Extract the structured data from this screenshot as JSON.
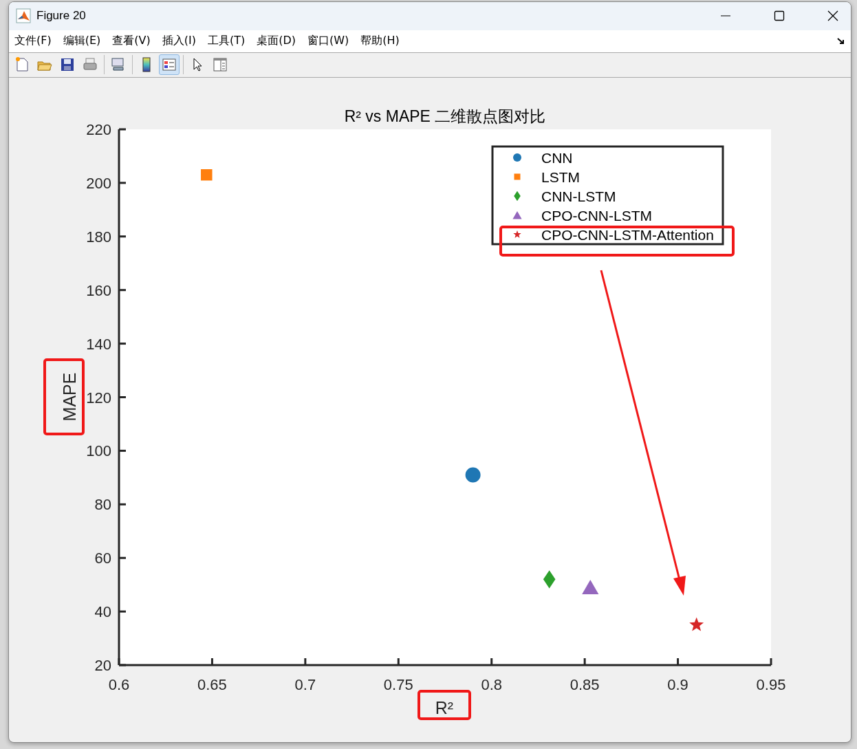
{
  "window": {
    "title": "Figure 20"
  },
  "menu": [
    "文件(F)",
    "编辑(E)",
    "查看(V)",
    "插入(I)",
    "工具(T)",
    "桌面(D)",
    "窗口(W)",
    "帮助(H)"
  ],
  "toolbar": [
    {
      "kind": "new",
      "selected": false
    },
    {
      "kind": "open",
      "selected": false
    },
    {
      "kind": "save",
      "selected": false
    },
    {
      "kind": "print",
      "selected": false
    },
    {
      "kind": "link",
      "selected": false
    },
    {
      "kind": "colorbar",
      "selected": false
    },
    {
      "kind": "legend",
      "selected": true
    },
    {
      "kind": "pointer",
      "selected": false
    },
    {
      "kind": "panel",
      "selected": false
    }
  ],
  "figure": {
    "chart_data": {
      "type": "scatter",
      "title": "R² vs MAPE 二维散点图对比",
      "xlabel": "R²",
      "ylabel": "MAPE",
      "xlim": [
        0.6,
        0.95
      ],
      "ylim": [
        20,
        220
      ],
      "xticks": [
        0.6,
        0.65,
        0.7,
        0.75,
        0.8,
        0.85,
        0.9,
        0.95
      ],
      "yticks": [
        20,
        40,
        60,
        80,
        100,
        120,
        140,
        160,
        180,
        200,
        220
      ],
      "legend": true,
      "series": [
        {
          "name": "CNN",
          "color": "#1f77b4",
          "marker": "circle",
          "x": [
            0.79
          ],
          "values": [
            91
          ]
        },
        {
          "name": "LSTM",
          "color": "#ff7f0e",
          "marker": "square",
          "x": [
            0.647
          ],
          "values": [
            203
          ]
        },
        {
          "name": "CNN-LSTM",
          "color": "#2ca02c",
          "marker": "diamond",
          "x": [
            0.831
          ],
          "values": [
            52
          ]
        },
        {
          "name": "CPO-CNN-LSTM",
          "color": "#9467bd",
          "marker": "triangle",
          "x": [
            0.853
          ],
          "values": [
            49
          ]
        },
        {
          "name": "CPO-CNN-LSTM-Attention",
          "color": "#d62728",
          "marker": "star",
          "x": [
            0.91
          ],
          "values": [
            35
          ]
        }
      ]
    }
  }
}
